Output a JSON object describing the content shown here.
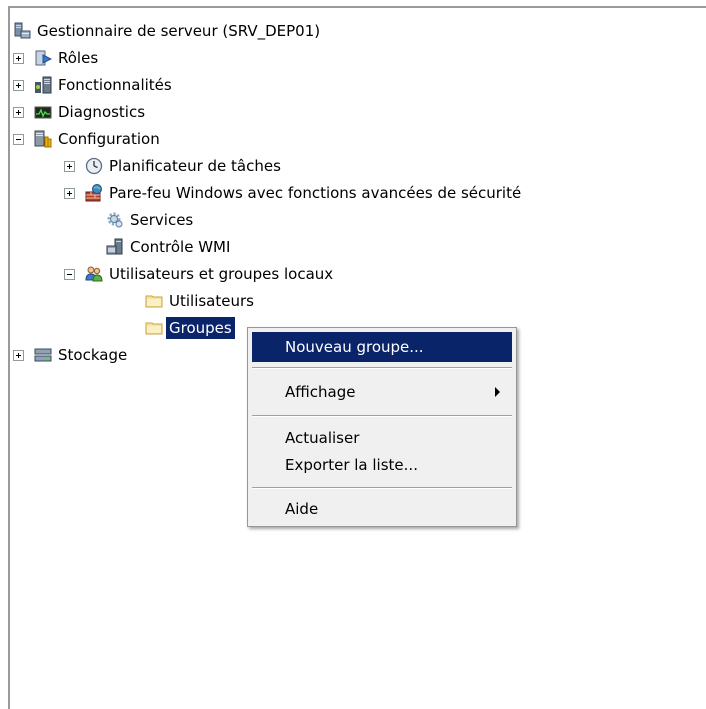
{
  "tree": {
    "root": {
      "label": "Gestionnaire de serveur (SRV_DEP01)",
      "icon": "server-manager-icon"
    },
    "items": {
      "roles": {
        "label": "Rôles",
        "icon": "roles-icon"
      },
      "features": {
        "label": "Fonctionnalités",
        "icon": "features-icon"
      },
      "diagnostics": {
        "label": "Diagnostics",
        "icon": "diagnostics-icon"
      },
      "configuration": {
        "label": "Configuration",
        "icon": "configuration-icon"
      },
      "task_scheduler": {
        "label": "Planificateur de tâches",
        "icon": "clock-icon"
      },
      "firewall": {
        "label": "Pare-feu Windows avec fonctions avancées de sécurité",
        "icon": "firewall-icon"
      },
      "services": {
        "label": "Services",
        "icon": "gear-icon"
      },
      "wmi": {
        "label": "Contrôle WMI",
        "icon": "wmi-icon"
      },
      "local_users_groups": {
        "label": "Utilisateurs et groupes locaux",
        "icon": "users-icon"
      },
      "users": {
        "label": "Utilisateurs",
        "icon": "folder-icon"
      },
      "groups": {
        "label": "Groupes",
        "icon": "folder-icon"
      },
      "storage": {
        "label": "Stockage",
        "icon": "storage-icon"
      }
    }
  },
  "context_menu": {
    "new_group": "Nouveau groupe...",
    "view": "Affichage",
    "refresh": "Actualiser",
    "export": "Exporter la liste...",
    "help": "Aide"
  },
  "colors": {
    "selection": "#0a246a",
    "menu_background": "#f0f0f0"
  }
}
